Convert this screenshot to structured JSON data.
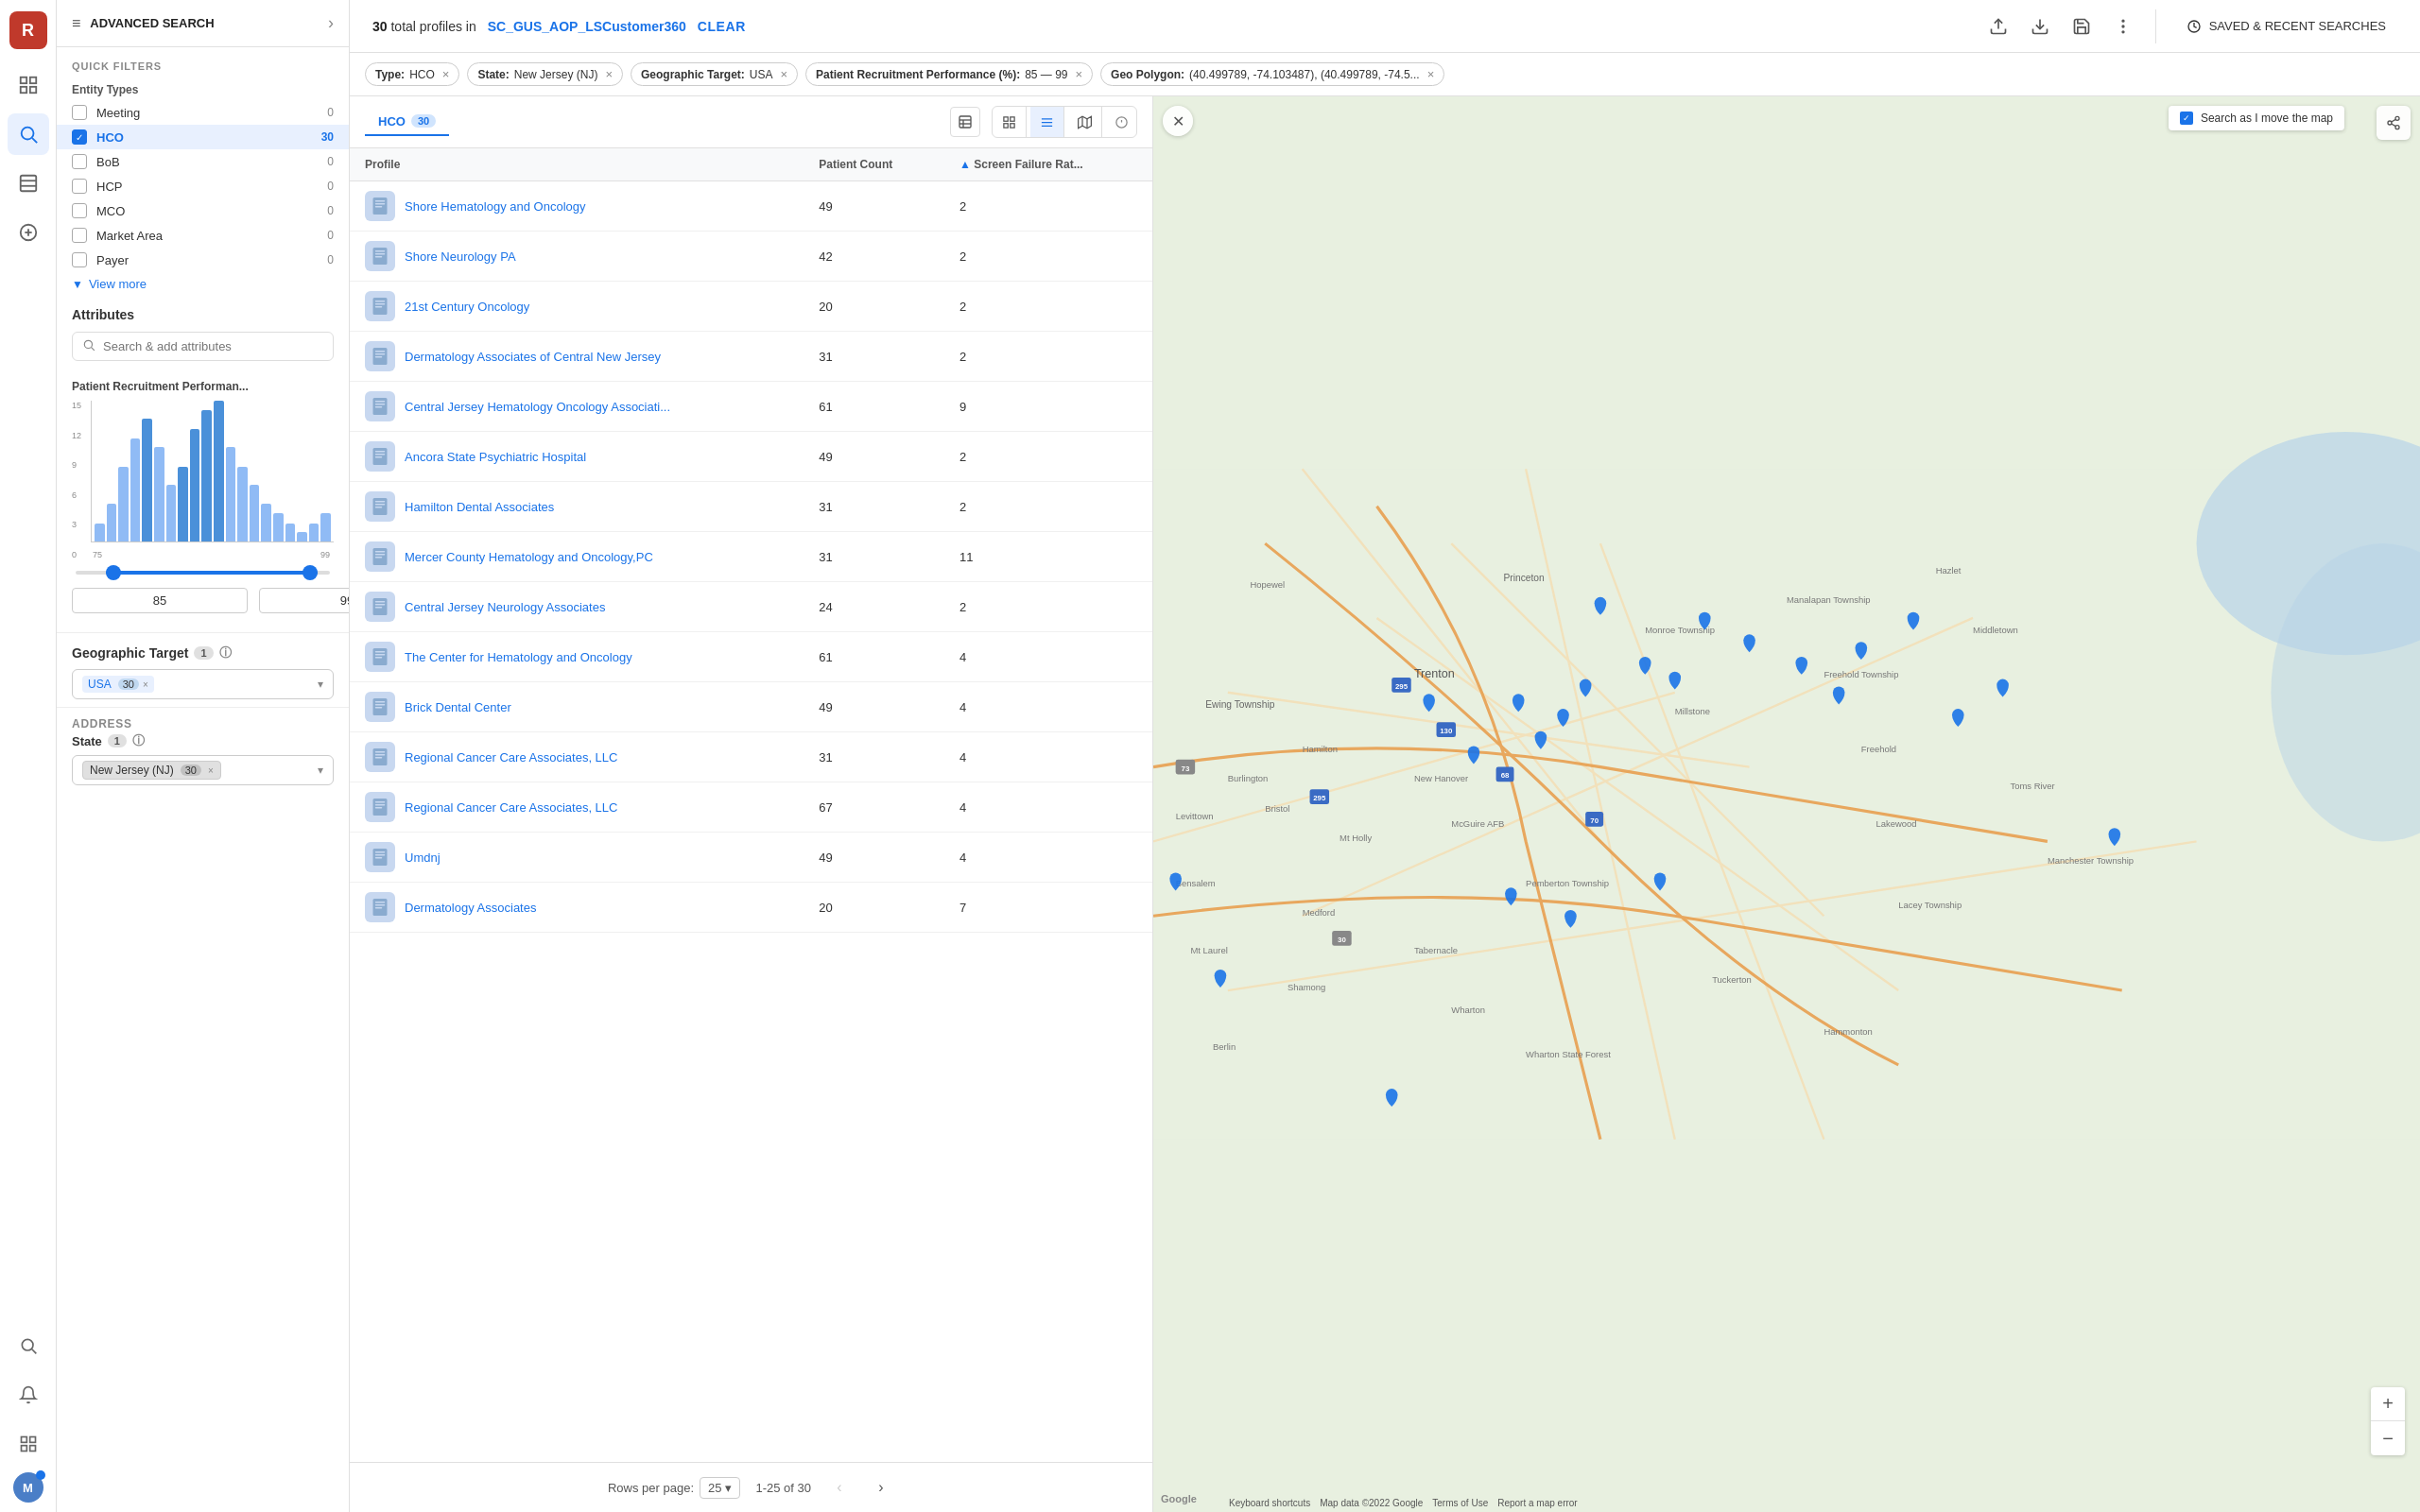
{
  "leftNav": {
    "icons": [
      {
        "name": "logo-icon",
        "symbol": "R",
        "active": false
      },
      {
        "name": "dashboard-icon",
        "symbol": "⊞",
        "active": false
      },
      {
        "name": "search-icon",
        "symbol": "🔍",
        "active": true
      },
      {
        "name": "list-icon",
        "symbol": "☰",
        "active": false
      },
      {
        "name": "plus-icon",
        "symbol": "＋",
        "active": false
      }
    ],
    "bottomIcons": [
      {
        "name": "search-bottom-icon",
        "symbol": "🔍"
      },
      {
        "name": "bell-icon",
        "symbol": "🔔"
      },
      {
        "name": "grid-icon",
        "symbol": "⊞"
      }
    ]
  },
  "sidebar": {
    "header": {
      "icon": "≡",
      "title": "ADVANCED SEARCH",
      "chevron": "›"
    },
    "quickFilters": {
      "label": "QUICK FILTERS",
      "entityTypesLabel": "Entity Types",
      "items": [
        {
          "name": "Meeting",
          "count": "0",
          "checked": false,
          "selected": false
        },
        {
          "name": "HCO",
          "count": "30",
          "checked": true,
          "selected": true
        },
        {
          "name": "BoB",
          "count": "0",
          "checked": false,
          "selected": false
        },
        {
          "name": "HCP",
          "count": "0",
          "checked": false,
          "selected": false
        },
        {
          "name": "MCO",
          "count": "0",
          "checked": false,
          "selected": false
        },
        {
          "name": "Market Area",
          "count": "0",
          "checked": false,
          "selected": false
        },
        {
          "name": "Payer",
          "count": "0",
          "checked": false,
          "selected": false
        }
      ],
      "viewMore": "View more"
    },
    "attributes": {
      "title": "Attributes",
      "searchPlaceholder": "Search & add attributes"
    },
    "chart": {
      "title": "Patient Recruitment Performan...",
      "yLabels": [
        "15",
        "12",
        "9",
        "6",
        "3",
        "0"
      ],
      "xLabels": [
        "75",
        "99"
      ],
      "bars": [
        2,
        4,
        8,
        12,
        14,
        10,
        6,
        8,
        12,
        14,
        16,
        10,
        8,
        6,
        4,
        3,
        2,
        1,
        2,
        3
      ],
      "rangeMin": "85",
      "rangeMax": "99"
    },
    "geoTarget": {
      "label": "Geographic Target",
      "badge": "1",
      "infoIcon": "ⓘ",
      "dropdownValue": "USA",
      "dropdownCount": "30",
      "removeLabel": "×"
    },
    "address": {
      "title": "Address",
      "stateLabel": "State",
      "stateBadge": "1",
      "stateValue": "New Jersey (NJ)",
      "stateCount": "30",
      "removeLabel": "×"
    }
  },
  "topBar": {
    "totalCount": "30",
    "totalLabel": "total profiles  in",
    "dbName": "SC_GUS_AOP_LSCustomer360",
    "clearBtn": "CLEAR",
    "icons": {
      "upload": "⬆",
      "download": "⬇",
      "save": "💾",
      "more": "⋮"
    },
    "savedSearchesLabel": "SAVED & RECENT SEARCHES"
  },
  "filterChips": [
    {
      "key": "Type:",
      "val": "HCO",
      "removable": true
    },
    {
      "key": "State:",
      "val": "New Jersey (NJ)",
      "removable": true
    },
    {
      "key": "Geographic Target:",
      "val": "USA",
      "removable": true
    },
    {
      "key": "Patient Recruitment Performance (%):",
      "val": "85 — 99",
      "removable": true
    },
    {
      "key": "Geo Polygon:",
      "val": "(40.499789, -74.103487), (40.499789, -74.5...",
      "removable": true
    }
  ],
  "tablePanel": {
    "tabs": [
      {
        "label": "HCO",
        "count": "30",
        "active": true
      }
    ],
    "viewIcons": [
      "⊞",
      "≡",
      "🗺",
      "ⓘ"
    ],
    "columns": [
      {
        "label": "Profile",
        "sortable": false
      },
      {
        "label": "Patient Count",
        "sortable": false
      },
      {
        "label": "Screen Failure Rat...",
        "sortable": true
      }
    ],
    "rows": [
      {
        "profile": "Shore Hematology and Oncology",
        "patientCount": "49",
        "screenFailure": "2"
      },
      {
        "profile": "Shore Neurology PA",
        "patientCount": "42",
        "screenFailure": "2"
      },
      {
        "profile": "21st Century Oncology",
        "patientCount": "20",
        "screenFailure": "2"
      },
      {
        "profile": "Dermatology Associates of Central New Jersey",
        "patientCount": "31",
        "screenFailure": "2"
      },
      {
        "profile": "Central Jersey Hematology Oncology Associati...",
        "patientCount": "61",
        "screenFailure": "9"
      },
      {
        "profile": "Ancora State Psychiatric Hospital",
        "patientCount": "49",
        "screenFailure": "2"
      },
      {
        "profile": "Hamilton Dental Associates",
        "patientCount": "31",
        "screenFailure": "2"
      },
      {
        "profile": "Mercer County Hematology and Oncology,PC",
        "patientCount": "31",
        "screenFailure": "11"
      },
      {
        "profile": "Central Jersey Neurology Associates",
        "patientCount": "24",
        "screenFailure": "2"
      },
      {
        "profile": "The Center for Hematology and Oncology",
        "patientCount": "61",
        "screenFailure": "4"
      },
      {
        "profile": "Brick Dental Center",
        "patientCount": "49",
        "screenFailure": "4"
      },
      {
        "profile": "Regional Cancer Care Associates, LLC",
        "patientCount": "31",
        "screenFailure": "4"
      },
      {
        "profile": "Regional Cancer Care Associates, LLC",
        "patientCount": "67",
        "screenFailure": "4"
      },
      {
        "profile": "Umdnj",
        "patientCount": "49",
        "screenFailure": "4"
      },
      {
        "profile": "Dermatology Associates",
        "patientCount": "20",
        "screenFailure": "7"
      }
    ],
    "pagination": {
      "rowsPerPageLabel": "Rows per page:",
      "rowsPerPageValue": "25",
      "pageRange": "1-25 of 30"
    }
  },
  "map": {
    "searchAsIMoveLabel": "Search as I move the map",
    "zoomIn": "+",
    "zoomOut": "−",
    "attribution": "Map data ©2022 Google  Terms of Use  Report a map error",
    "keyboardShortcuts": "Keyboard shortcuts"
  }
}
